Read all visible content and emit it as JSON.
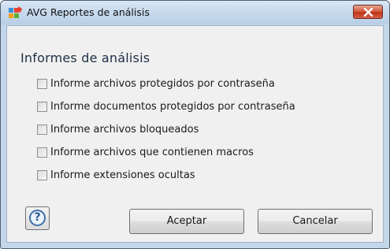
{
  "window": {
    "title": "AVG Reportes de análisis",
    "icon": "avg-logo-icon",
    "close_icon": "close-icon"
  },
  "dialog": {
    "heading": "Informes de análisis",
    "options": [
      {
        "label": "Informe archivos protegidos por contraseña",
        "checked": false
      },
      {
        "label": "Informe documentos protegidos por contraseña",
        "checked": false
      },
      {
        "label": "Informe archivos bloqueados",
        "checked": false
      },
      {
        "label": "Informe archivos que contienen macros",
        "checked": false
      },
      {
        "label": "Informe extensiones ocultas",
        "checked": false
      }
    ]
  },
  "buttons": {
    "help_symbol": "?",
    "accept_label": "Aceptar",
    "cancel_label": "Cancelar"
  },
  "colors": {
    "title_bar": "#c7d9ed",
    "close_button": "#c8432a",
    "dialog_background": "#f0f0f0",
    "heading_text": "#1e2f45"
  }
}
